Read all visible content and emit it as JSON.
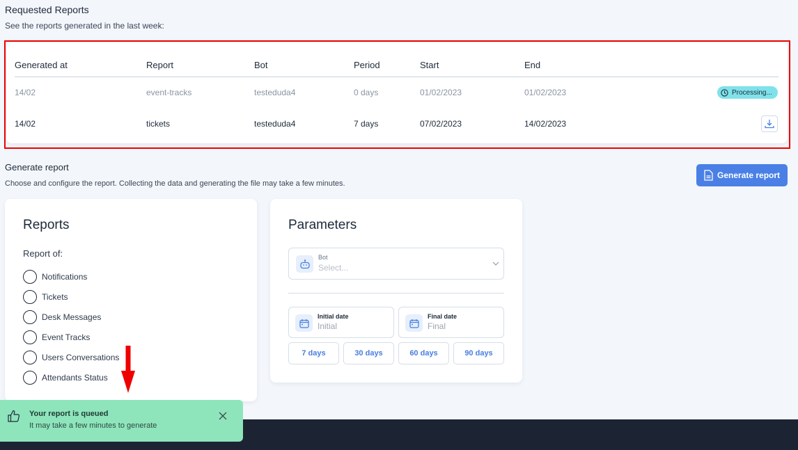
{
  "requested": {
    "title": "Requested Reports",
    "subtitle": "See the reports generated in the last week:",
    "columns": [
      "Generated at",
      "Report",
      "Bot",
      "Period",
      "Start",
      "End"
    ],
    "rows": [
      {
        "generated": "14/02",
        "report": "event-tracks",
        "bot": "testeduda4",
        "period": "0 days",
        "start": "01/02/2023",
        "end": "01/02/2023",
        "status": "Processing..."
      },
      {
        "generated": "14/02",
        "report": "tickets",
        "bot": "testeduda4",
        "period": "7 days",
        "start": "07/02/2023",
        "end": "14/02/2023",
        "status": "download"
      }
    ]
  },
  "generate": {
    "title": "Generate report",
    "subtitle": "Choose and configure the report. Collecting the data and generating the file may take a few minutes.",
    "button": "Generate report"
  },
  "reports": {
    "title": "Reports",
    "label": "Report of:",
    "options": [
      "Notifications",
      "Tickets",
      "Desk Messages",
      "Event Tracks",
      "Users Conversations",
      "Attendants Status"
    ]
  },
  "parameters": {
    "title": "Parameters",
    "bot_label": "Bot",
    "bot_placeholder": "Select...",
    "initial_label": "Initial date",
    "initial_placeholder": "Initial",
    "final_label": "Final date",
    "final_placeholder": "Final",
    "presets": [
      "7 days",
      "30 days",
      "60 days",
      "90 days"
    ]
  },
  "toast": {
    "title": "Your report is queued",
    "message": "It may take a few minutes to generate",
    "color": "#8ee5bb"
  },
  "colors": {
    "accent": "#4a80e6",
    "annotation": "#ee0000",
    "processing": "#7fe2ea"
  }
}
